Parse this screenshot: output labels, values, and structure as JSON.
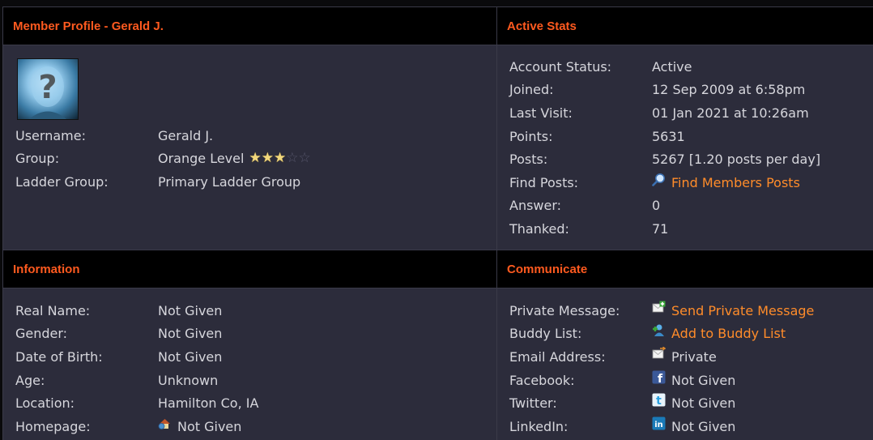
{
  "sections": {
    "profile_title": "Member Profile - Gerald J.",
    "stats_title": "Active Stats",
    "info_title": "Information",
    "communicate_title": "Communicate"
  },
  "profile": {
    "rows": [
      {
        "label": "Username:",
        "value": "Gerald J."
      },
      {
        "label": "Group:",
        "value": "Orange Level"
      },
      {
        "label": "Ladder Group:",
        "value": "Primary Ladder Group"
      }
    ],
    "rating": {
      "filled": 3,
      "total": 5
    }
  },
  "stats": {
    "rows": [
      {
        "label": "Account Status:",
        "value": "Active"
      },
      {
        "label": "Joined:",
        "value": "12 Sep 2009 at 6:58pm"
      },
      {
        "label": "Last Visit:",
        "value": "01 Jan 2021 at 10:26am"
      },
      {
        "label": "Points:",
        "value": "5631"
      },
      {
        "label": "Posts:",
        "value": "5267 [1.20 posts per day]"
      },
      {
        "label": "Find Posts:",
        "value": "Find Members Posts"
      },
      {
        "label": "Answer:",
        "value": "0"
      },
      {
        "label": "Thanked:",
        "value": "71"
      }
    ]
  },
  "info": {
    "rows": [
      {
        "label": "Real Name:",
        "value": "Not Given"
      },
      {
        "label": "Gender:",
        "value": "Not Given"
      },
      {
        "label": "Date of Birth:",
        "value": "Not Given"
      },
      {
        "label": "Age:",
        "value": "Unknown"
      },
      {
        "label": "Location:",
        "value": "Hamilton Co, IA"
      },
      {
        "label": "Homepage:",
        "value": "Not Given"
      }
    ]
  },
  "communicate": {
    "rows": [
      {
        "label": "Private Message:",
        "value": "Send Private Message"
      },
      {
        "label": "Buddy List:",
        "value": "Add to Buddy List"
      },
      {
        "label": "Email Address:",
        "value": "Private"
      },
      {
        "label": "Facebook:",
        "value": "Not Given"
      },
      {
        "label": "Twitter:",
        "value": "Not Given"
      },
      {
        "label": "LinkedIn:",
        "value": "Not Given"
      }
    ]
  },
  "colors": {
    "header_text": "#ff5a1f",
    "link_text": "#ff8c2a",
    "panel_bg": "#2c2c3b",
    "header_bg": "#000000"
  },
  "icons": {
    "find_posts": "magnifier-icon",
    "private_message": "message-plus-icon",
    "buddy_list": "add-user-icon",
    "email": "email-icon",
    "facebook": "facebook-icon",
    "twitter": "twitter-icon",
    "linkedin": "linkedin-icon",
    "homepage": "home-icon"
  }
}
